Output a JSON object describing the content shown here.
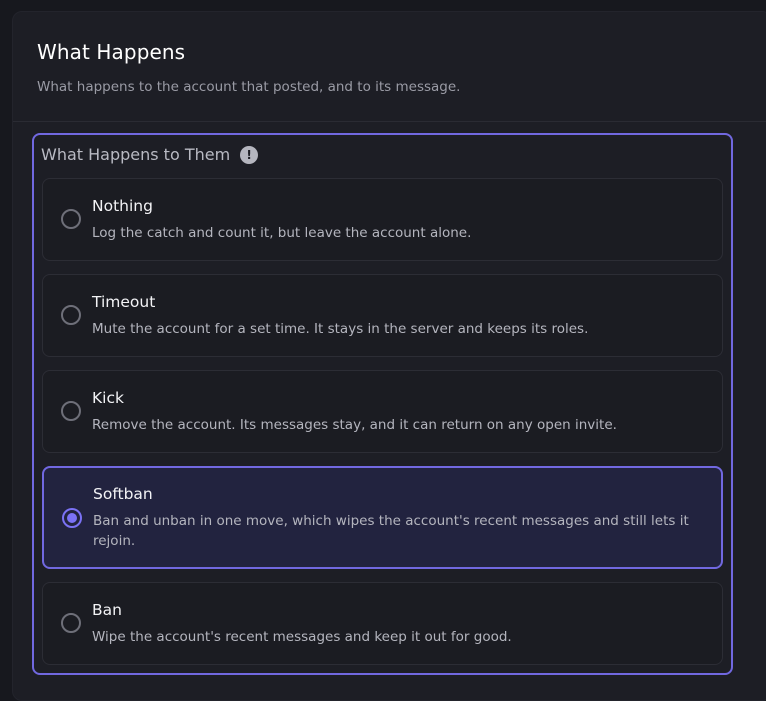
{
  "card": {
    "title": "What Happens",
    "description": "What happens to the account that posted, and to its message."
  },
  "group": {
    "legend": "What Happens to Them",
    "info_icon": "exclamation-circle-icon",
    "selected": "Softban",
    "options": [
      {
        "label": "Nothing",
        "description": "Log the catch and count it, but leave the account alone."
      },
      {
        "label": "Timeout",
        "description": "Mute the account for a set time. It stays in the server and keeps its roles."
      },
      {
        "label": "Kick",
        "description": "Remove the account. Its messages stay, and it can return on any open invite."
      },
      {
        "label": "Softban",
        "description": "Ban and unban in one move, which wipes the account's recent messages and still lets it rejoin."
      },
      {
        "label": "Ban",
        "description": "Wipe the account's recent messages and keep it out for good."
      }
    ]
  },
  "colors": {
    "accent": "#7168e0",
    "background": "#17181e",
    "card": "#1d1e25",
    "selected_bg": "#22233f"
  }
}
